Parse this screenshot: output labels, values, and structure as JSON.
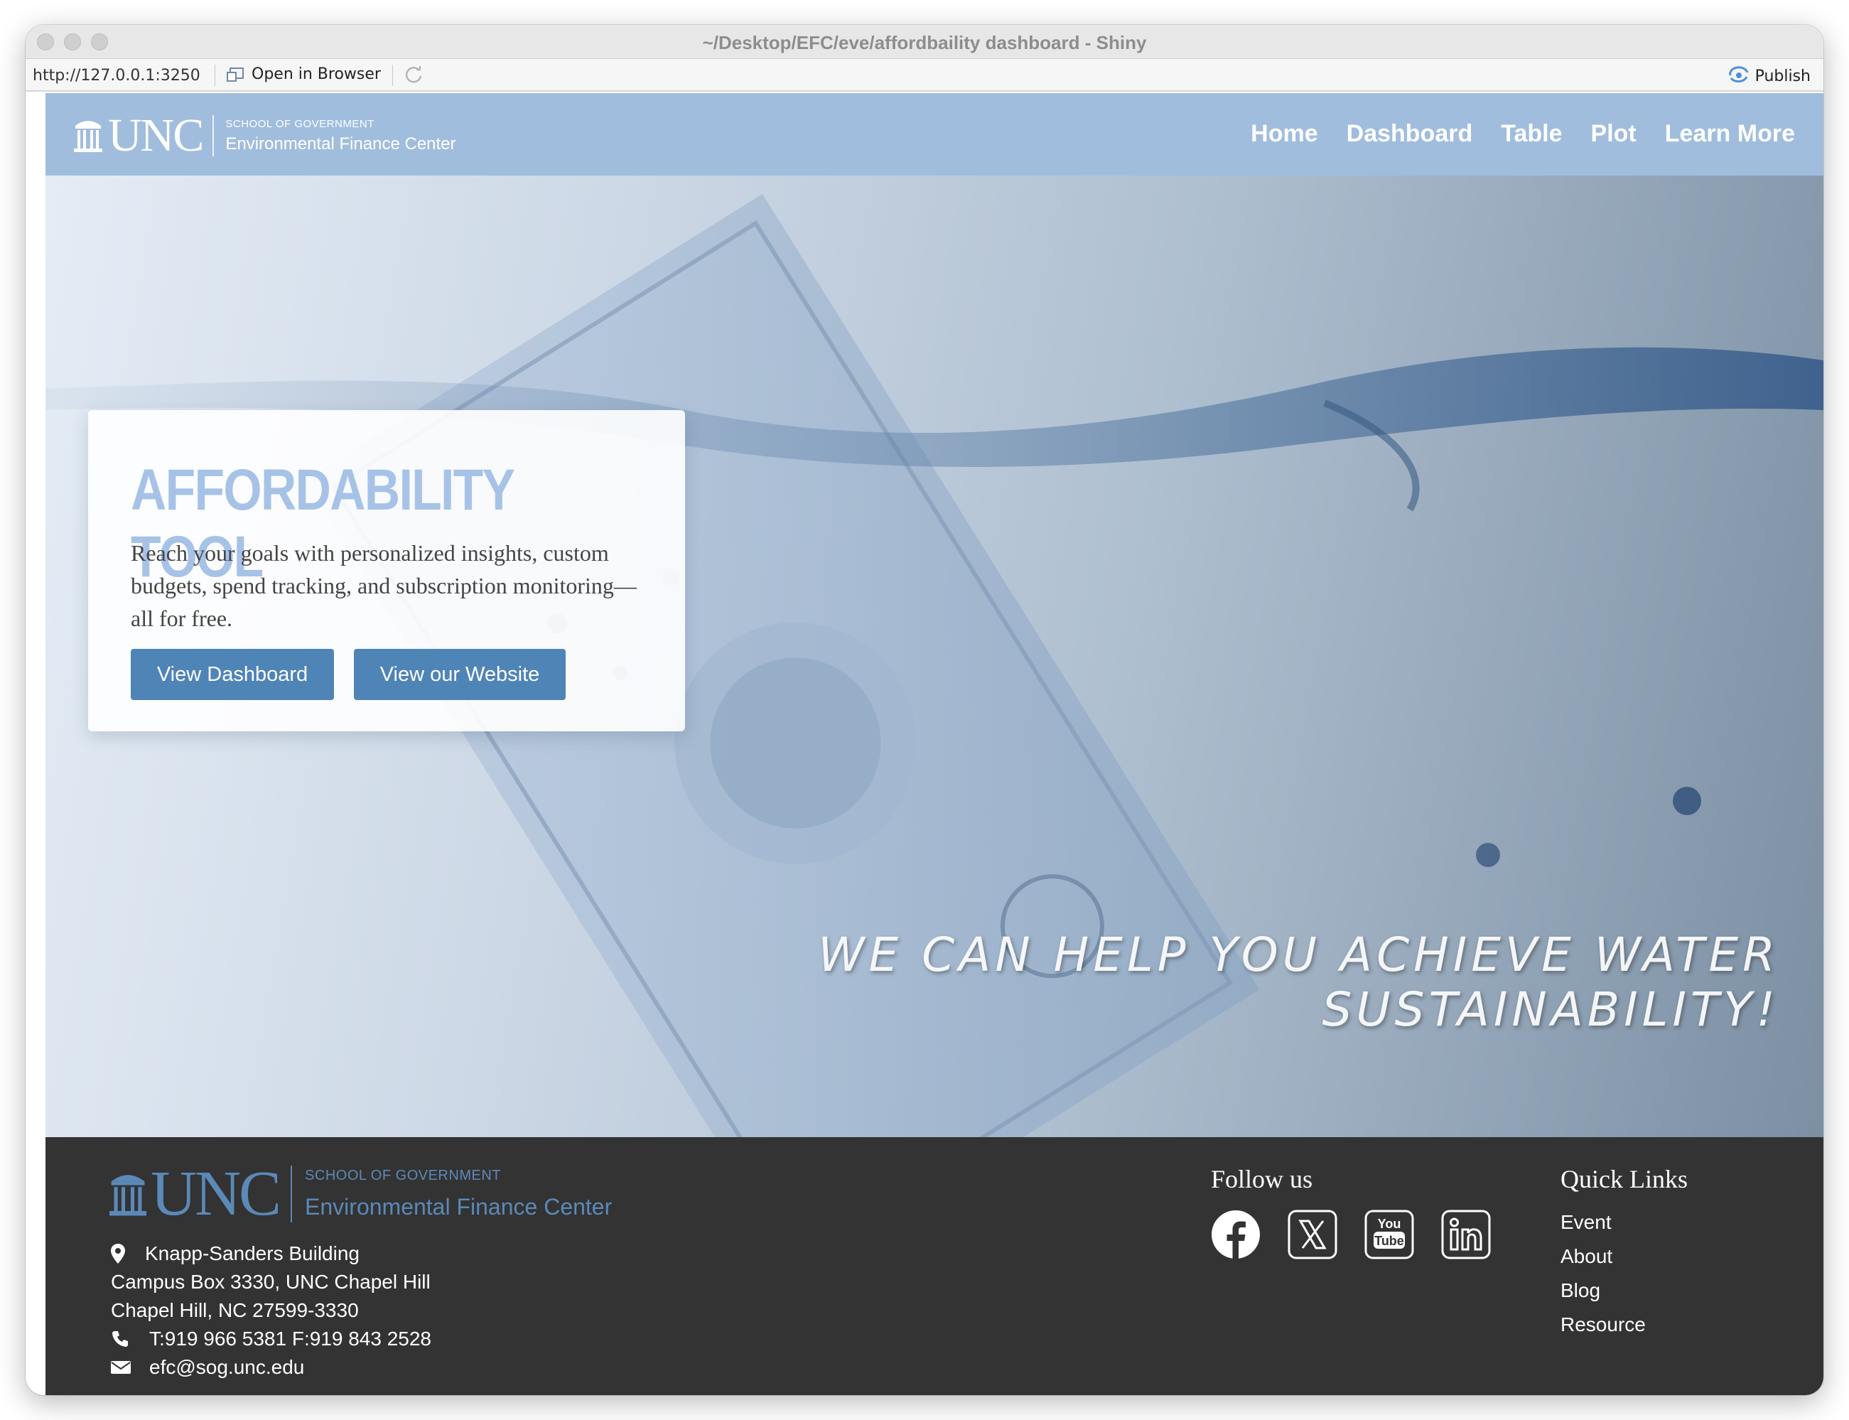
{
  "window": {
    "title": "~/Desktop/EFC/eve/affordbaility dashboard - Shiny"
  },
  "toolbar": {
    "url": "http://127.0.0.1:3250",
    "open_in_browser": "Open in Browser",
    "publish": "Publish"
  },
  "brand": {
    "name": "UNC",
    "small": "SCHOOL OF GOVERNMENT",
    "big": "Environmental Finance Center"
  },
  "nav": {
    "items": [
      "Home",
      "Dashboard",
      "Table",
      "Plot",
      "Learn More"
    ]
  },
  "hero": {
    "title": "AFFORDABILITY TOOL",
    "text": "Reach your goals with personalized insights, custom budgets, spend tracking, and subscription monitoring—all for free.",
    "btn_dashboard": "View Dashboard",
    "btn_website": "View our Website",
    "slogan": "WE CAN HELP YOU ACHIEVE WATER SUSTAINABILITY!"
  },
  "footer": {
    "brand": {
      "name": "UNC",
      "small": "SCHOOL OF GOVERNMENT",
      "big": "Environmental Finance Center"
    },
    "address": {
      "line1": "Knapp-Sanders Building",
      "line2": "Campus Box 3330, UNC Chapel Hill",
      "line3": "Chapel Hill, NC 27599-3330",
      "phone": "T:919 966 5381 F:919 843 2528",
      "email": "efc@sog.unc.edu"
    },
    "follow_title": "Follow us",
    "social_icons": [
      "facebook-icon",
      "x-twitter-icon",
      "youtube-icon",
      "linkedin-icon"
    ],
    "quick_links_title": "Quick Links",
    "quick_links": [
      "Event",
      "About",
      "Blog",
      "Resource"
    ]
  },
  "colors": {
    "navbar": "#a1bddd",
    "button": "#4f84b6",
    "hero_title": "#a7c2e7",
    "footer_bg": "#333333",
    "footer_brand": "#5b89b8"
  }
}
